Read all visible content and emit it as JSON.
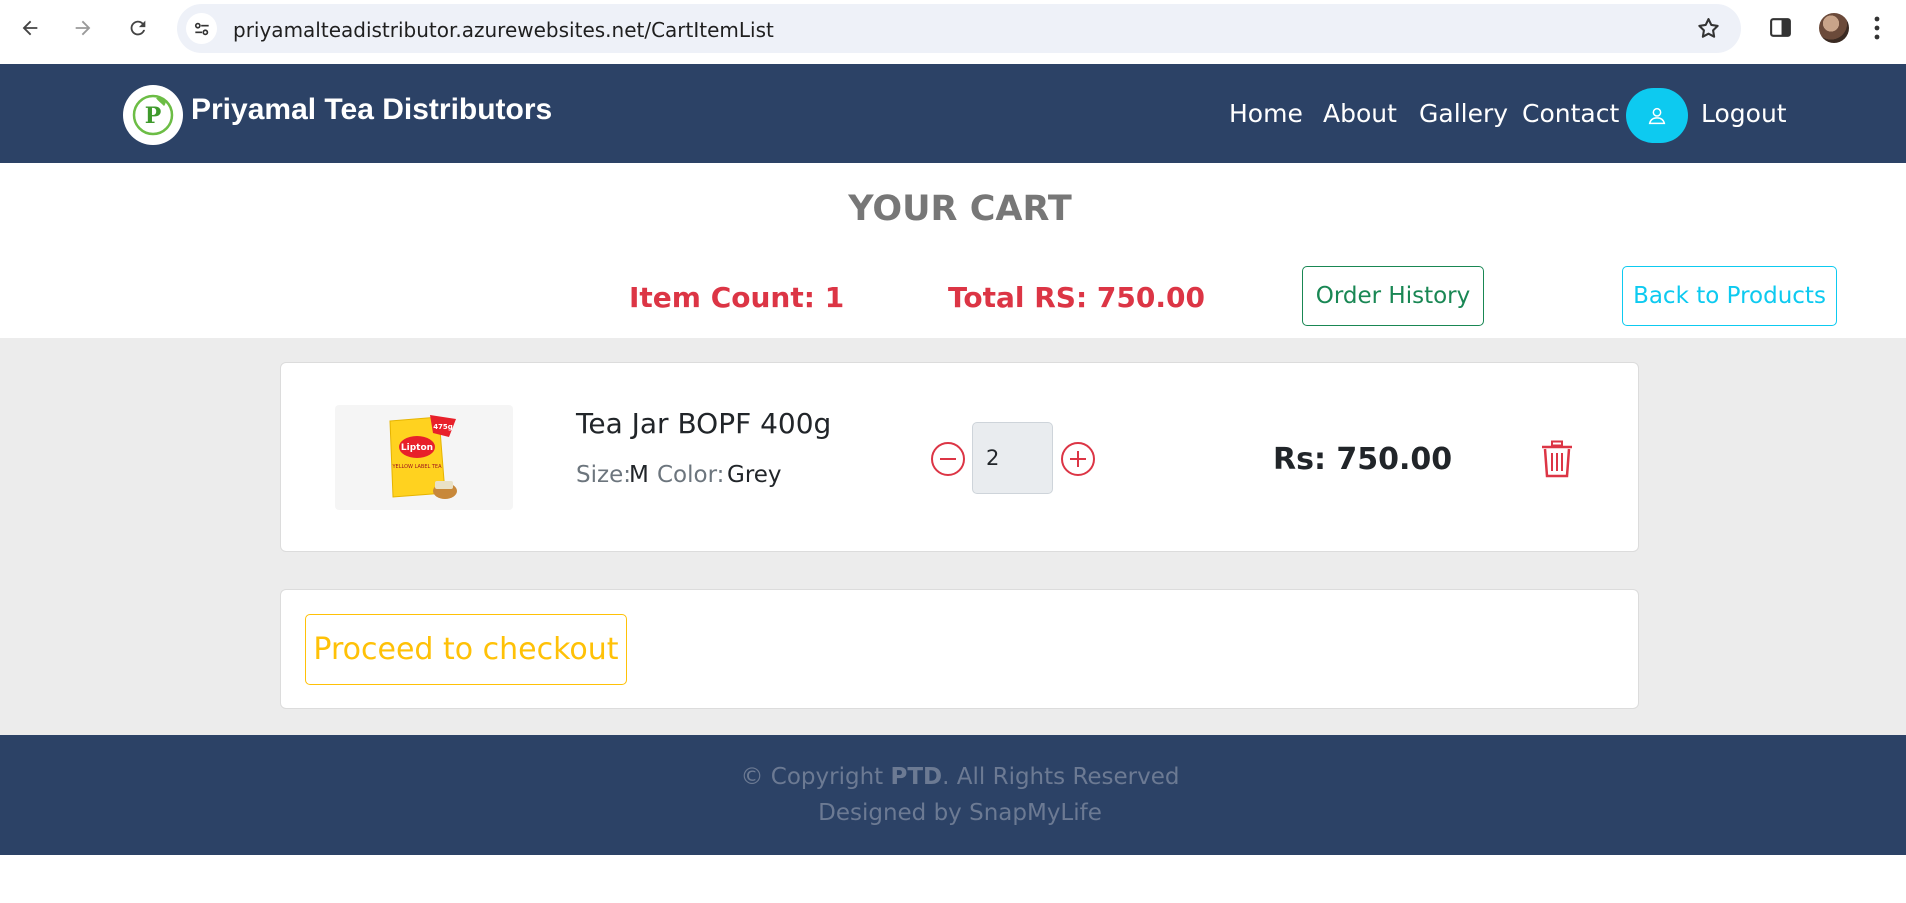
{
  "browser": {
    "url": "priyamalteadistributor.azurewebsites.net/CartItemList",
    "icons": [
      "back-arrow-icon",
      "forward-arrow-icon",
      "reload-icon",
      "site-settings-icon",
      "bookmark-star-icon",
      "side-panel-icon",
      "profile-avatar",
      "more-menu-icon"
    ]
  },
  "header": {
    "brand": "Priyamal Tea Distributors",
    "logo_letter": "P",
    "nav": [
      "Home",
      "About",
      "Gallery",
      "Contact"
    ],
    "logout": "Logout",
    "colors": {
      "bar": "#2c4266",
      "user_button": "#0dcaf0"
    }
  },
  "cart": {
    "title": "YOUR CART",
    "item_count": "Item Count: 1",
    "total": "Total RS: 750.00",
    "order_history": "Order History",
    "back_to_products": "Back to Products"
  },
  "item": {
    "name": "Tea Jar BOPF 400g",
    "size_label": "Size:",
    "size_value": "M",
    "color_label": "Color:",
    "color_value": "Grey",
    "quantity": "2",
    "price": "Rs: 750.00",
    "image_badge": "475g",
    "image_brand": "Lipton",
    "image_subtitle": "YELLOW LABEL TEA"
  },
  "checkout": {
    "label": "Proceed to checkout"
  },
  "footer": {
    "copyright_prefix": "© Copyright ",
    "copyright_brand": "PTD",
    "copyright_suffix": ". All Rights Reserved",
    "designed_by": "Designed by SnapMyLife"
  }
}
